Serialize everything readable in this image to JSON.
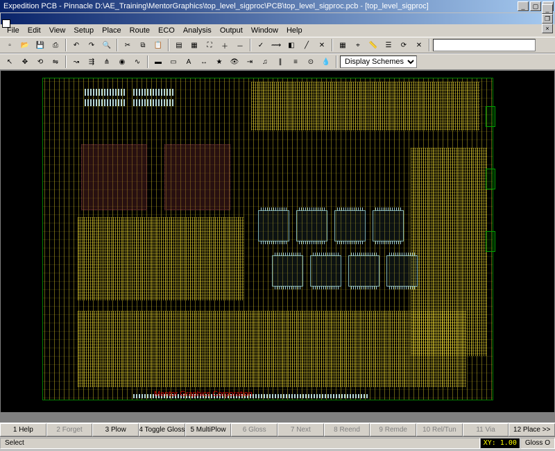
{
  "titlebar": {
    "text": "Expedition PCB - Pinnacle  D:\\AE_Training\\MentorGraphics\\top_level_sigproc\\PCB\\top_level_sigproc.pcb - [top_level_sigproc]"
  },
  "menu": {
    "items": [
      "File",
      "Edit",
      "View",
      "Setup",
      "Place",
      "Route",
      "ECO",
      "Analysis",
      "Output",
      "Window",
      "Help"
    ]
  },
  "toolbar2_combo": {
    "label": "Display Schemes"
  },
  "canvas": {
    "copyright": "Mentor Graphics Corporation"
  },
  "bottom_buttons": [
    {
      "label": "1 Help",
      "enabled": true
    },
    {
      "label": "2 Forget",
      "enabled": false
    },
    {
      "label": "3 Plow",
      "enabled": true
    },
    {
      "label": "4 Toggle Gloss",
      "enabled": true
    },
    {
      "label": "5 MultiPlow",
      "enabled": true
    },
    {
      "label": "6 Gloss",
      "enabled": false
    },
    {
      "label": "7 Next",
      "enabled": false
    },
    {
      "label": "8 Reend",
      "enabled": false
    },
    {
      "label": "9 Remde",
      "enabled": false
    },
    {
      "label": "10 Rel/Tun",
      "enabled": false
    },
    {
      "label": "11 Via",
      "enabled": false
    },
    {
      "label": "12 Place >>",
      "enabled": true
    }
  ],
  "status": {
    "mode": "Select",
    "xy": "XY: 1.00",
    "gloss": "Gloss O"
  },
  "colors": {
    "trace_signal": "#e6d232",
    "trace_power": "#884444",
    "silkscreen": "#008000",
    "pad": "#b8d8d8",
    "text_warn": "#cc0000"
  }
}
